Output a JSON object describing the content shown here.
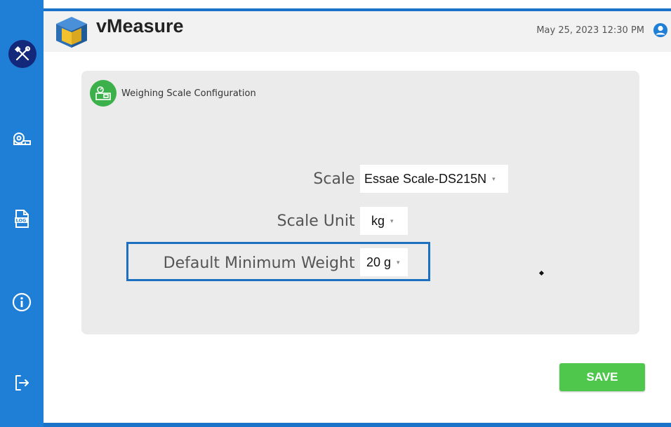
{
  "app": {
    "title": "vMeasure",
    "datetime": "May 25, 2023 12:30 PM"
  },
  "sidebar": {
    "items": [
      {
        "icon": "tools-icon",
        "active": true
      },
      {
        "icon": "measuring-tape-icon",
        "active": false
      },
      {
        "icon": "log-icon",
        "active": false
      },
      {
        "icon": "info-icon",
        "active": false
      },
      {
        "icon": "logout-icon",
        "active": false
      }
    ]
  },
  "panel": {
    "title": "Weighing Scale Configuration",
    "icon": "weighing-scale-icon",
    "fields": {
      "scale": {
        "label": "Scale :",
        "value": "Essae Scale-DS215N"
      },
      "scale_unit": {
        "label": "Scale Unit :",
        "value": "kg"
      },
      "default_min_weight": {
        "label": "Default Minimum Weight :",
        "value": "20 g"
      }
    }
  },
  "actions": {
    "save_label": "SAVE"
  },
  "colors": {
    "sidebar": "#1f7fd6",
    "active_nav": "#13287a",
    "highlight_border": "#1d6fc0",
    "save_button": "#4fc74c",
    "panel_icon": "#3cb04a"
  }
}
